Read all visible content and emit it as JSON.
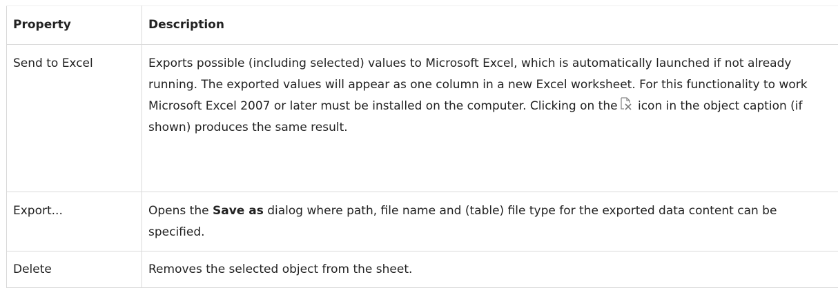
{
  "table": {
    "header": {
      "property": "Property",
      "description": "Description"
    },
    "rows": [
      {
        "property": "Send to Excel",
        "description_before_icon": "Exports possible (including selected) values to Microsoft Excel, which is automatically launched if not already running. The exported values will appear as one column in a new Excel worksheet. For this functionality to work Microsoft Excel 2007 or later must be installed on the computer. Clicking on the",
        "icon": "excel-export-icon",
        "description_after_icon": "icon in the object caption (if shown) produces the same result."
      },
      {
        "property": "Export...",
        "description_before_bold": "Opens the",
        "description_bold": "Save as",
        "description_after_bold": "dialog where path, file name and (table) file type for the exported data content can be specified."
      },
      {
        "property": "Delete",
        "description": "Removes the selected object from the sheet."
      }
    ]
  }
}
